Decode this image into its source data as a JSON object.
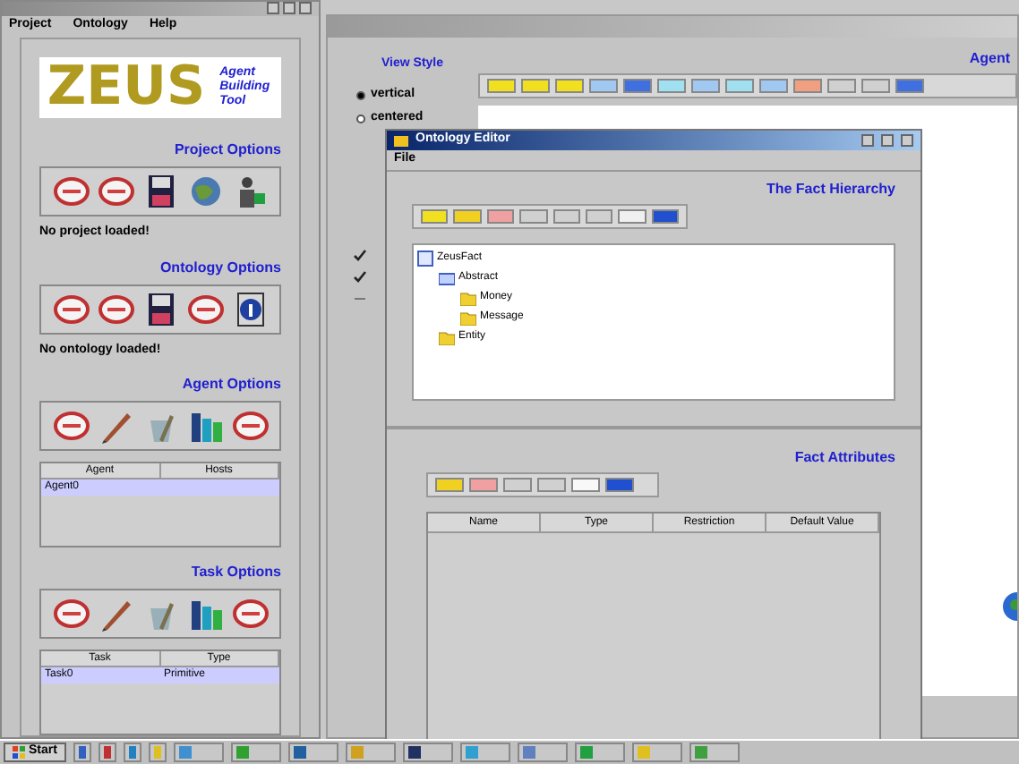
{
  "main_window": {
    "menu": [
      "Project",
      "Ontology",
      "Help"
    ],
    "logo": {
      "title": "ZEUS",
      "subtitle": "Agent Building Tool"
    },
    "sections": [
      {
        "kind": "status",
        "title": "Project Options",
        "status": "No project loaded!"
      },
      {
        "kind": "status",
        "title": "Ontology Options",
        "status": "No ontology loaded!"
      },
      {
        "kind": "table",
        "title": "Agent Options",
        "columns": [
          "Agent",
          "Hosts"
        ],
        "rows": [
          {
            "cells": [
              "Agent0"
            ],
            "selected": true
          }
        ]
      },
      {
        "kind": "table",
        "title": "Task Options",
        "columns": [
          "Task",
          "Type"
        ],
        "rows": [
          {
            "cells": [
              "Task0",
              "Primitive"
            ],
            "selected": true
          }
        ]
      }
    ]
  },
  "society_viewer": {
    "view_style": "View Style",
    "options": [
      {
        "label": "vertical",
        "selected": true
      },
      {
        "label": "centered",
        "selected": false
      }
    ],
    "checks": [
      {
        "checked": true
      },
      {
        "checked": true
      },
      {
        "checked": false
      }
    ],
    "agents_label": "Agent"
  },
  "ontology_editor": {
    "title": "Ontology Editor",
    "menu": [
      "File"
    ],
    "hierarchy_title": "The Fact Hierarchy",
    "tree": [
      {
        "label": "ZeusFact",
        "children": [
          {
            "label": "Abstract",
            "children": [
              {
                "label": "Money"
              },
              {
                "label": "Message"
              }
            ]
          },
          {
            "label": "Entity"
          }
        ]
      }
    ],
    "attributes_title": "Fact Attributes",
    "columns": [
      "Name",
      "Type",
      "Restriction",
      "Default Value"
    ]
  },
  "taskbar": {
    "start": "Start"
  }
}
